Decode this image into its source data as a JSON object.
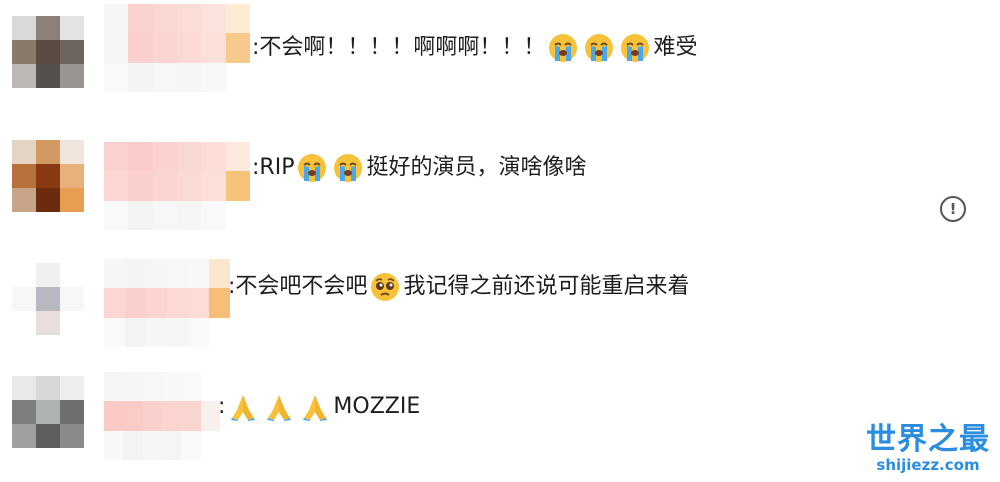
{
  "comments": [
    {
      "prefix": ":",
      "parts": [
        "不会啊！！！！啊啊啊！！！",
        "难受"
      ],
      "emojis_mid": [
        "loudly-crying",
        "loudly-crying",
        "loudly-crying"
      ]
    },
    {
      "prefix": ":",
      "parts": [
        "RIP",
        "挺好的演员，演啥像啥"
      ],
      "emojis_mid": [
        "loudly-crying",
        "loudly-crying"
      ]
    },
    {
      "prefix": ":",
      "parts": [
        "不会吧不会吧",
        "我记得之前还说可能重启来着"
      ],
      "emojis_mid": [
        "pleading-face"
      ]
    },
    {
      "prefix": ":",
      "parts": [
        "",
        "MOZZIE"
      ],
      "emojis_mid": [
        "folded-hands",
        "folded-hands",
        "folded-hands"
      ]
    }
  ],
  "report_icon": "exclamation-circle-icon",
  "watermark": {
    "title": "世界之最",
    "url": "shijiezz.com"
  },
  "colors": {
    "text": "#1d1d1d",
    "watermark": "#2b8de0",
    "emoji_yellow": "#f7c23a",
    "tear_blue": "#4aa8e8"
  }
}
